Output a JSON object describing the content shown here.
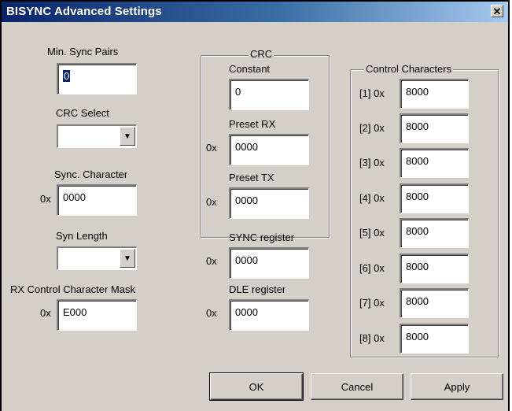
{
  "window": {
    "title": "BISYNC Advanced Settings",
    "close_glyph": "✕"
  },
  "left": {
    "min_sync_pairs": {
      "label": "Min. Sync Pairs",
      "value": "0"
    },
    "crc_select": {
      "label": "CRC Select",
      "value": ""
    },
    "sync_character": {
      "label": "Sync. Character",
      "prefix": "0x",
      "value": "0000"
    },
    "syn_length": {
      "label": "Syn Length",
      "value": ""
    },
    "rx_mask": {
      "label": "RX Control Character Mask",
      "prefix": "0x",
      "value": "E000"
    }
  },
  "crc_group": {
    "legend": "CRC",
    "constant": {
      "label": "Constant",
      "value": "0"
    },
    "preset_rx": {
      "label": "Preset RX",
      "prefix": "0x",
      "value": "0000"
    },
    "preset_tx": {
      "label": "Preset TX",
      "prefix": "0x",
      "value": "0000"
    }
  },
  "sync_register": {
    "label": "SYNC register",
    "prefix": "0x",
    "value": "0000"
  },
  "dle_register": {
    "label": "DLE register",
    "prefix": "0x",
    "value": "0000"
  },
  "control_characters": {
    "legend": "Control Characters",
    "items": [
      {
        "label": "[1] 0x",
        "value": "8000"
      },
      {
        "label": "[2] 0x",
        "value": "8000"
      },
      {
        "label": "[3] 0x",
        "value": "8000"
      },
      {
        "label": "[4] 0x",
        "value": "8000"
      },
      {
        "label": "[5] 0x",
        "value": "8000"
      },
      {
        "label": "[6] 0x",
        "value": "8000"
      },
      {
        "label": "[7] 0x",
        "value": "8000"
      },
      {
        "label": "[8] 0x",
        "value": "8000"
      }
    ]
  },
  "buttons": {
    "ok": "OK",
    "cancel": "Cancel",
    "apply": "Apply"
  }
}
